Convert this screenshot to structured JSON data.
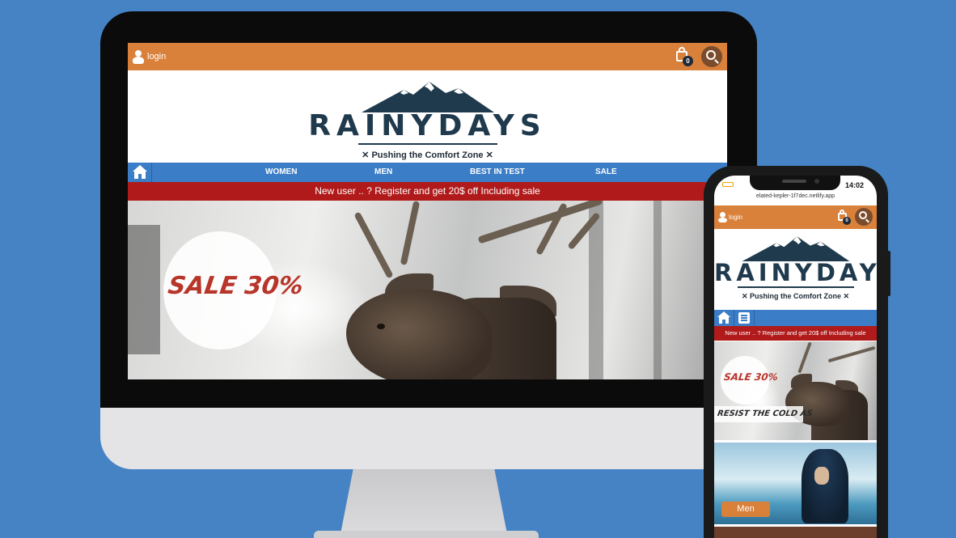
{
  "desktop": {
    "topbar": {
      "login_label": "login",
      "cart_count": "0"
    },
    "logo": {
      "wordmark": "RAINYDAYS",
      "tagline": "✕ Pushing the Comfort Zone ✕"
    },
    "nav": {
      "items": [
        "WOMEN",
        "MEN",
        "BEST IN TEST",
        "SALE"
      ]
    },
    "promo": "New user .. ? Register and get 20$ off Including sale",
    "hero": {
      "sale_text": "SALE 30%"
    }
  },
  "mobile": {
    "status": {
      "time": "14:02"
    },
    "url": "elated-kepler-1f7dec.netlify.app",
    "topbar": {
      "login_label": "login",
      "cart_count": "0"
    },
    "logo": {
      "wordmark": "RAINYDAYS",
      "tagline": "✕ Pushing the Comfort Zone ✕"
    },
    "promo": "New user .. ? Register and get 20$ off Including sale",
    "hero": {
      "sale_text": "SALE 30%",
      "caption": "RESIST THE COLD AS"
    },
    "cta": {
      "men_label": "Men"
    }
  },
  "colors": {
    "background": "#4583c4",
    "topbar": "#d9803a",
    "nav": "#3b7dc7",
    "promo": "#b01a1a",
    "logo_text": "#1f3a4d"
  }
}
